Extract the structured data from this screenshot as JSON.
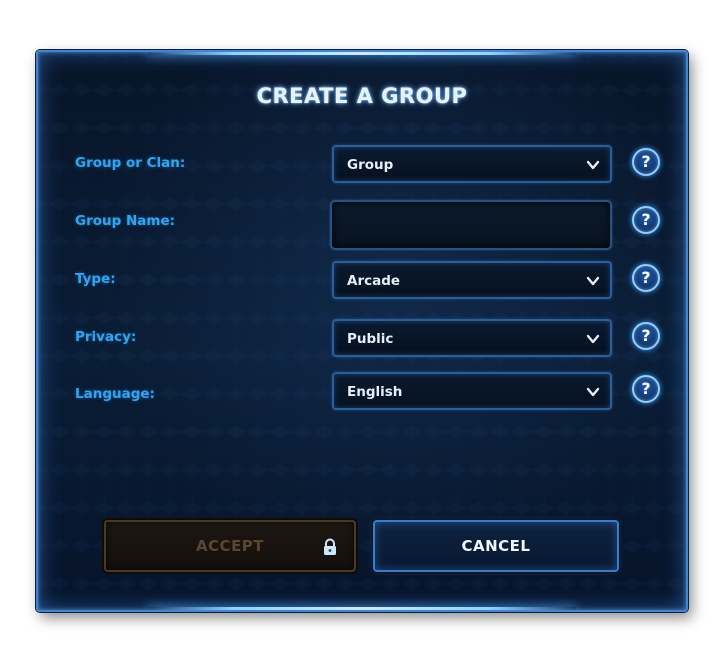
{
  "dialog": {
    "title": "CREATE A GROUP"
  },
  "fields": [
    {
      "label": "Group or Clan:",
      "kind": "select",
      "value": "Group",
      "help": "?"
    },
    {
      "label": "Group Name:",
      "kind": "text",
      "value": "",
      "help": "?"
    },
    {
      "label": "Type:",
      "kind": "select",
      "value": "Arcade",
      "help": "?"
    },
    {
      "label": "Privacy:",
      "kind": "select",
      "value": "Public",
      "help": "?"
    },
    {
      "label": "Language:",
      "kind": "select",
      "value": "English",
      "help": "?"
    }
  ],
  "buttons": {
    "accept_label": "ACCEPT",
    "accept_state": "disabled",
    "cancel_label": "CANCEL"
  },
  "icons": {
    "dropdown": "chevron-down-icon",
    "help": "question-mark-icon",
    "lock": "lock-icon"
  },
  "colors": {
    "label": "#2ea6f0",
    "title": "#e8f3ff",
    "accent_border": "#3f86d6",
    "accept_disabled_text": "#5b4634"
  }
}
